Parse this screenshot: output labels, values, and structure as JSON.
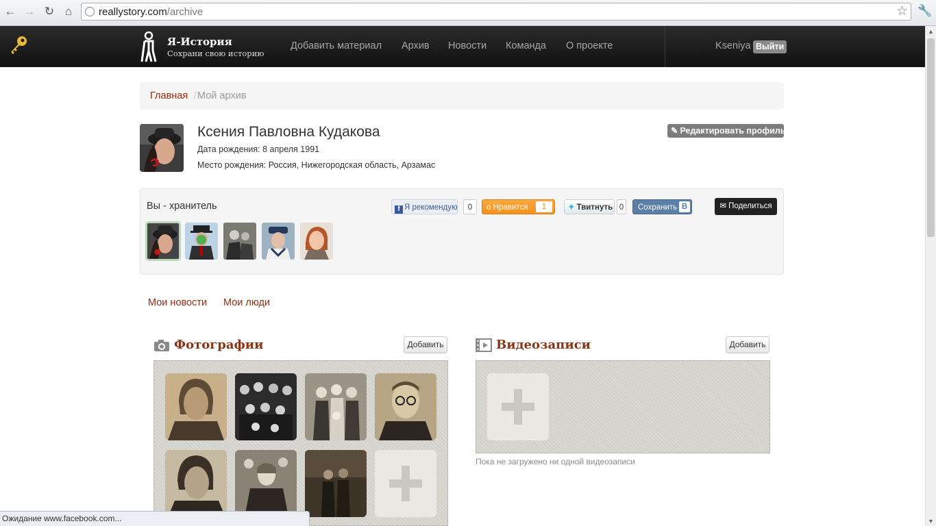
{
  "browser": {
    "url_host": "reallystory.com",
    "url_path": "/archive",
    "status_text": "Ожидание www.facebook.com..."
  },
  "site": {
    "logo_title": "Я-История",
    "logo_subtitle": "Сохрани свою историю",
    "nav": [
      "Добавить материал",
      "Архив",
      "Новости",
      "Команда",
      "О проекте"
    ],
    "username": "Kseniya",
    "logout_label": "Выйти"
  },
  "breadcrumb": {
    "home": "Главная",
    "separator": "/",
    "current": "Мой архив"
  },
  "profile": {
    "name": "Ксения Павловна Кудакова",
    "birth_date": "Дата рождения: 8 апреля 1991",
    "birth_place": "Место рождения: Россия, Нижегородская область, Арзамас",
    "edit_label": "Редактировать профиль"
  },
  "keeper": {
    "title": "Вы - хранитель",
    "avatars": [
      "woman-in-hat",
      "man-with-apple",
      "old-photo",
      "boy-sailor",
      "woman-portrait"
    ]
  },
  "social": {
    "facebook_label": "Я рекомендую",
    "facebook_count": "0",
    "ok_label": "Нравится",
    "ok_count": "1",
    "twitter_label": "Твитнуть",
    "twitter_count": "0",
    "vk_label": "Сохранить",
    "vk_badge": "В",
    "share_label": "Поделиться"
  },
  "tabs": [
    "Мои новости",
    "Мои люди"
  ],
  "photos": {
    "title": "Фотографии",
    "add_label": "Добавить",
    "items": [
      "woman-portrait-sepia",
      "group-photo",
      "family-photo",
      "man-glasses",
      "woman-bw",
      "woman-group",
      "couple-dark"
    ]
  },
  "videos": {
    "title": "Видеозаписи",
    "add_label": "Добавить",
    "empty_text": "Пока не загружено ни одной видеозаписи"
  },
  "colors": {
    "accent": "#8b2e12",
    "header_bg": "#1a1a1a",
    "ok_orange": "#f5921d",
    "vk_blue": "#5b7fa6",
    "fb_blue": "#3b5998"
  }
}
